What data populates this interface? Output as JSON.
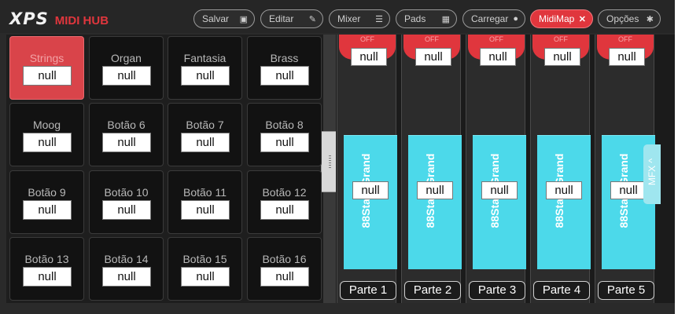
{
  "app": {
    "logo_brand": "XPS",
    "logo_sub": "MIDI HUB"
  },
  "toolbar": [
    {
      "label": "Salvar",
      "icon": "save-icon",
      "glyph": "▣"
    },
    {
      "label": "Editar",
      "icon": "edit-icon",
      "glyph": "✎"
    },
    {
      "label": "Mixer",
      "icon": "sliders-icon",
      "glyph": "☰"
    },
    {
      "label": "Pads",
      "icon": "grid-icon",
      "glyph": "▦"
    },
    {
      "label": "Carregar",
      "icon": "load-icon",
      "glyph": "●"
    },
    {
      "label": "MidiMap",
      "icon": "close-icon",
      "glyph": "✕",
      "active": true
    },
    {
      "label": "Opções",
      "icon": "gear-icon",
      "glyph": "✱"
    }
  ],
  "pads": [
    {
      "label": "Strings",
      "value": "null",
      "selected": true
    },
    {
      "label": "Organ",
      "value": "null"
    },
    {
      "label": "Fantasia",
      "value": "null"
    },
    {
      "label": "Brass",
      "value": "null"
    },
    {
      "label": "Moog",
      "value": "null"
    },
    {
      "label": "Botão 6",
      "value": "null"
    },
    {
      "label": "Botão 7",
      "value": "null"
    },
    {
      "label": "Botão 8",
      "value": "null"
    },
    {
      "label": "Botão 9",
      "value": "null"
    },
    {
      "label": "Botão 10",
      "value": "null"
    },
    {
      "label": "Botão 11",
      "value": "null"
    },
    {
      "label": "Botão 12",
      "value": "null"
    },
    {
      "label": "Botão 13",
      "value": "null"
    },
    {
      "label": "Botão 14",
      "value": "null"
    },
    {
      "label": "Botão 15",
      "value": "null"
    },
    {
      "label": "Botão 16",
      "value": "null"
    }
  ],
  "channels": [
    {
      "off_label": "OFF",
      "top_value": "null",
      "fader_value": "null",
      "tone": "88StageGrand",
      "part": "Parte 1"
    },
    {
      "off_label": "OFF",
      "top_value": "null",
      "fader_value": "null",
      "tone": "88StageGrand",
      "part": "Parte 2"
    },
    {
      "off_label": "OFF",
      "top_value": "null",
      "fader_value": "null",
      "tone": "88StageGrand",
      "part": "Parte 3"
    },
    {
      "off_label": "OFF",
      "top_value": "null",
      "fader_value": "null",
      "tone": "88StageGrand",
      "part": "Parte 4"
    },
    {
      "off_label": "OFF",
      "top_value": "null",
      "fader_value": "null",
      "tone": "88StageGrand",
      "part": "Parte 5"
    }
  ],
  "mfx_tab": "MFX ^",
  "colors": {
    "accent_red": "#e0363d",
    "fader_cyan": "#4cd9ea"
  }
}
